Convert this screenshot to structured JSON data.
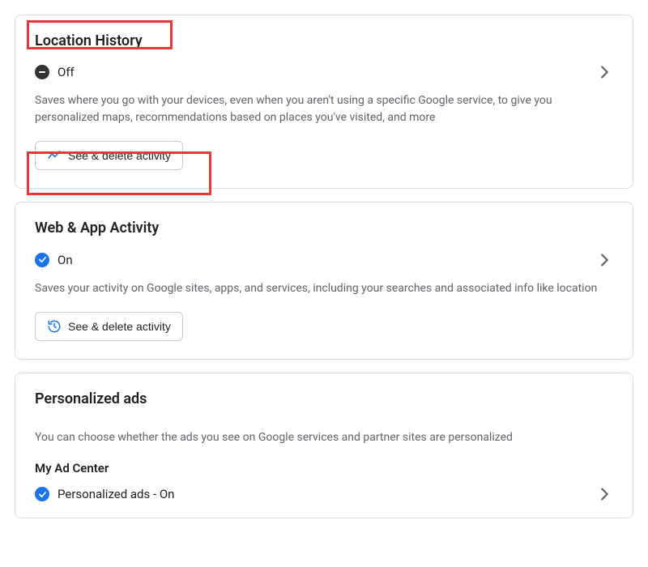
{
  "cards": {
    "location": {
      "title": "Location History",
      "status_label": "Off",
      "status_on": false,
      "description": "Saves where you go with your devices, even when you aren't using a specific Google service, to give you personalized maps, recommendations based on places you've visited, and more",
      "action_label": "See & delete activity"
    },
    "web": {
      "title": "Web & App Activity",
      "status_label": "On",
      "status_on": true,
      "description": "Saves your activity on Google sites, apps, and services, including your searches and associated info like location",
      "action_label": "See & delete activity"
    },
    "ads": {
      "title": "Personalized ads",
      "description": "You can choose whether the ads you see on Google services and partner sites are personalized",
      "subhead": "My Ad Center",
      "status_label": "Personalized ads - On",
      "status_on": true
    }
  }
}
